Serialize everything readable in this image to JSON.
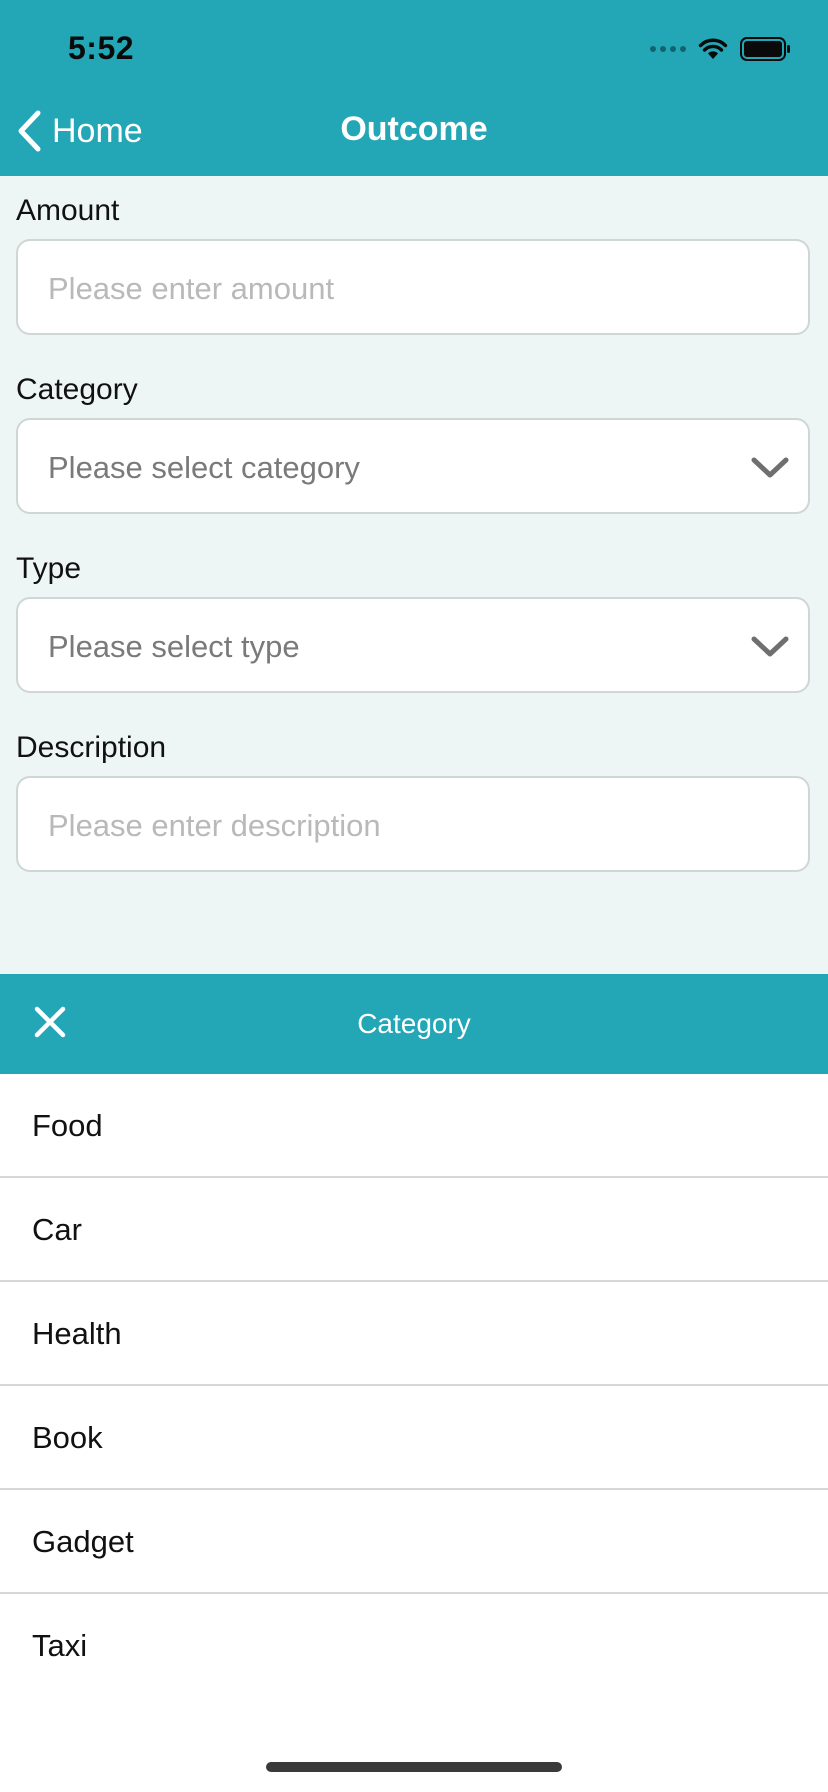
{
  "status_bar": {
    "time": "5:52"
  },
  "nav": {
    "back_label": "Home",
    "title": "Outcome"
  },
  "form": {
    "amount": {
      "label": "Amount",
      "placeholder": "Please enter amount"
    },
    "category": {
      "label": "Category",
      "placeholder": "Please select category"
    },
    "type": {
      "label": "Type",
      "placeholder": "Please select type"
    },
    "description": {
      "label": "Description",
      "placeholder": "Please enter description"
    }
  },
  "picker": {
    "title": "Category",
    "options": [
      "Food",
      "Car",
      "Health",
      "Book",
      "Gadget",
      "Taxi"
    ]
  },
  "colors": {
    "accent": "#23a6b5",
    "form_background": "#eef6f5"
  },
  "icons": {
    "back": "chevron-left-icon",
    "dropdown": "chevron-down-icon",
    "close": "close-icon",
    "wifi": "wifi-icon",
    "battery": "battery-icon",
    "signal": "signal-icon"
  }
}
